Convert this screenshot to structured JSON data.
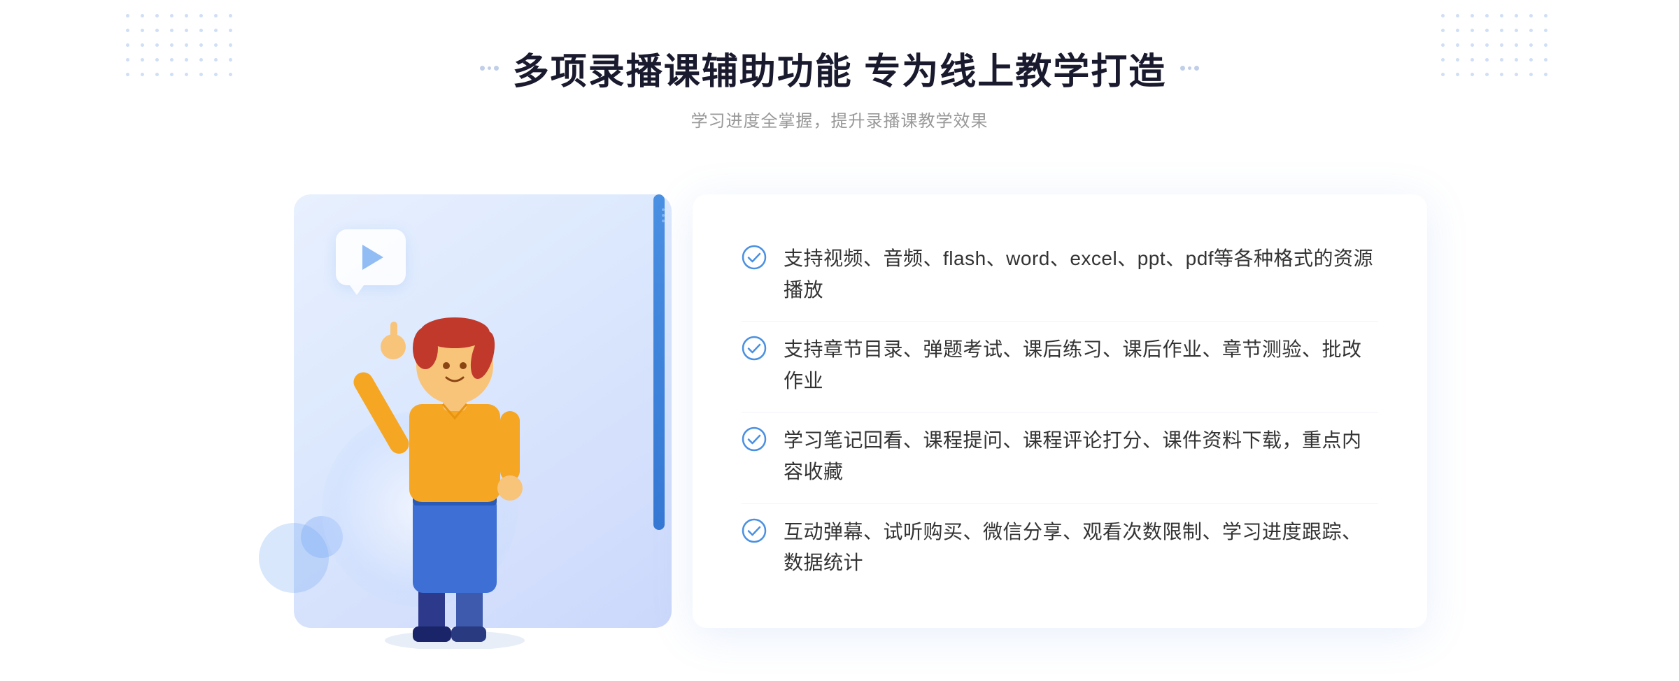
{
  "header": {
    "title": "多项录播课辅助功能 专为线上教学打造",
    "subtitle": "学习进度全掌握，提升录播课教学效果",
    "decorator_dots": 6
  },
  "features": [
    {
      "id": 1,
      "text": "支持视频、音频、flash、word、excel、ppt、pdf等各种格式的资源播放"
    },
    {
      "id": 2,
      "text": "支持章节目录、弹题考试、课后练习、课后作业、章节测验、批改作业"
    },
    {
      "id": 3,
      "text": "学习笔记回看、课程提问、课程评论打分、课件资料下载，重点内容收藏"
    },
    {
      "id": 4,
      "text": "互动弹幕、试听购买、微信分享、观看次数限制、学习进度跟踪、数据统计"
    }
  ],
  "decoration": {
    "flash_label": "flash ,"
  },
  "colors": {
    "primary_blue": "#4a90e2",
    "light_blue": "#dce8fd",
    "check_color": "#4a90e2",
    "title_color": "#1a1a2e",
    "text_color": "#333333",
    "subtitle_color": "#999999"
  }
}
